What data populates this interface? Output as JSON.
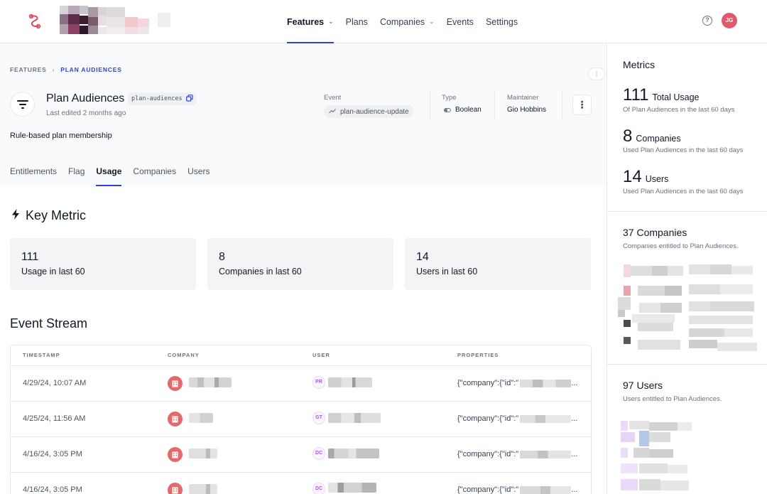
{
  "nav": {
    "links": [
      {
        "label": "Features",
        "has_caret": true,
        "active": true
      },
      {
        "label": "Plans",
        "has_caret": false
      },
      {
        "label": "Companies",
        "has_caret": true
      },
      {
        "label": "Events",
        "has_caret": false
      },
      {
        "label": "Settings",
        "has_caret": false
      }
    ],
    "help_icon": "question-circle-icon",
    "user_initials": "JG",
    "accent": "#2b44d6"
  },
  "breadcrumb": {
    "root": "FEATURES",
    "current": "PLAN AUDIENCES"
  },
  "feature": {
    "title": "Plan Audiences",
    "key": "plan-audiences",
    "edited": "Last edited 2 months ago",
    "description": "Rule-based plan membership"
  },
  "meta": {
    "event_label": "Event",
    "event_value": "plan-audience-update",
    "type_label": "Type",
    "type_value": "Boolean",
    "maintainer_label": "Maintainer",
    "maintainer_value": "Gio Hobbins",
    "more_label": "⋮"
  },
  "tabs": [
    {
      "label": "Entitlements",
      "active": false
    },
    {
      "label": "Flag",
      "active": false
    },
    {
      "label": "Usage",
      "active": true
    },
    {
      "label": "Companies",
      "active": false
    },
    {
      "label": "Users",
      "active": false
    }
  ],
  "key_metric": {
    "title": "Key Metric",
    "cards": [
      {
        "value": "111",
        "label": "Usage in last 60"
      },
      {
        "value": "8",
        "label": "Companies in last 60"
      },
      {
        "value": "14",
        "label": "Users in last 60"
      }
    ]
  },
  "event_stream": {
    "title": "Event Stream",
    "columns": [
      "TIMESTAMP",
      "COMPANY",
      "USER",
      "PROPERTIES"
    ],
    "rows": [
      {
        "timestamp": "4/29/24, 10:07 AM",
        "user_initials": "PR",
        "properties": "{\"company\":{\"id\":\""
      },
      {
        "timestamp": "4/25/24, 11:56 AM",
        "user_initials": "GT",
        "properties": "{\"company\":{\"id\":\""
      },
      {
        "timestamp": "4/16/24, 3:05 PM",
        "user_initials": "DC",
        "properties": "{\"company\":{\"id\":\""
      },
      {
        "timestamp": "4/16/24, 3:05 PM",
        "user_initials": "DC",
        "properties": "{\"company\":{\"id\":\""
      }
    ]
  },
  "metrics_panel": {
    "title": "Metrics",
    "items": [
      {
        "value": "111",
        "label": "Total Usage",
        "sub": "Of Plan Audiences in the last 60 days"
      },
      {
        "value": "8",
        "label": "Companies",
        "sub": "Used Plan Audiences in the last 60 days"
      },
      {
        "value": "14",
        "label": "Users",
        "sub": "Used Plan Audiences in the last 60 days"
      }
    ],
    "companies_title": "37 Companies",
    "companies_sub": "Companies entitled to Plan Audiences.",
    "users_title": "97 Users",
    "users_sub": "Users entitled to Plan Audiences."
  }
}
